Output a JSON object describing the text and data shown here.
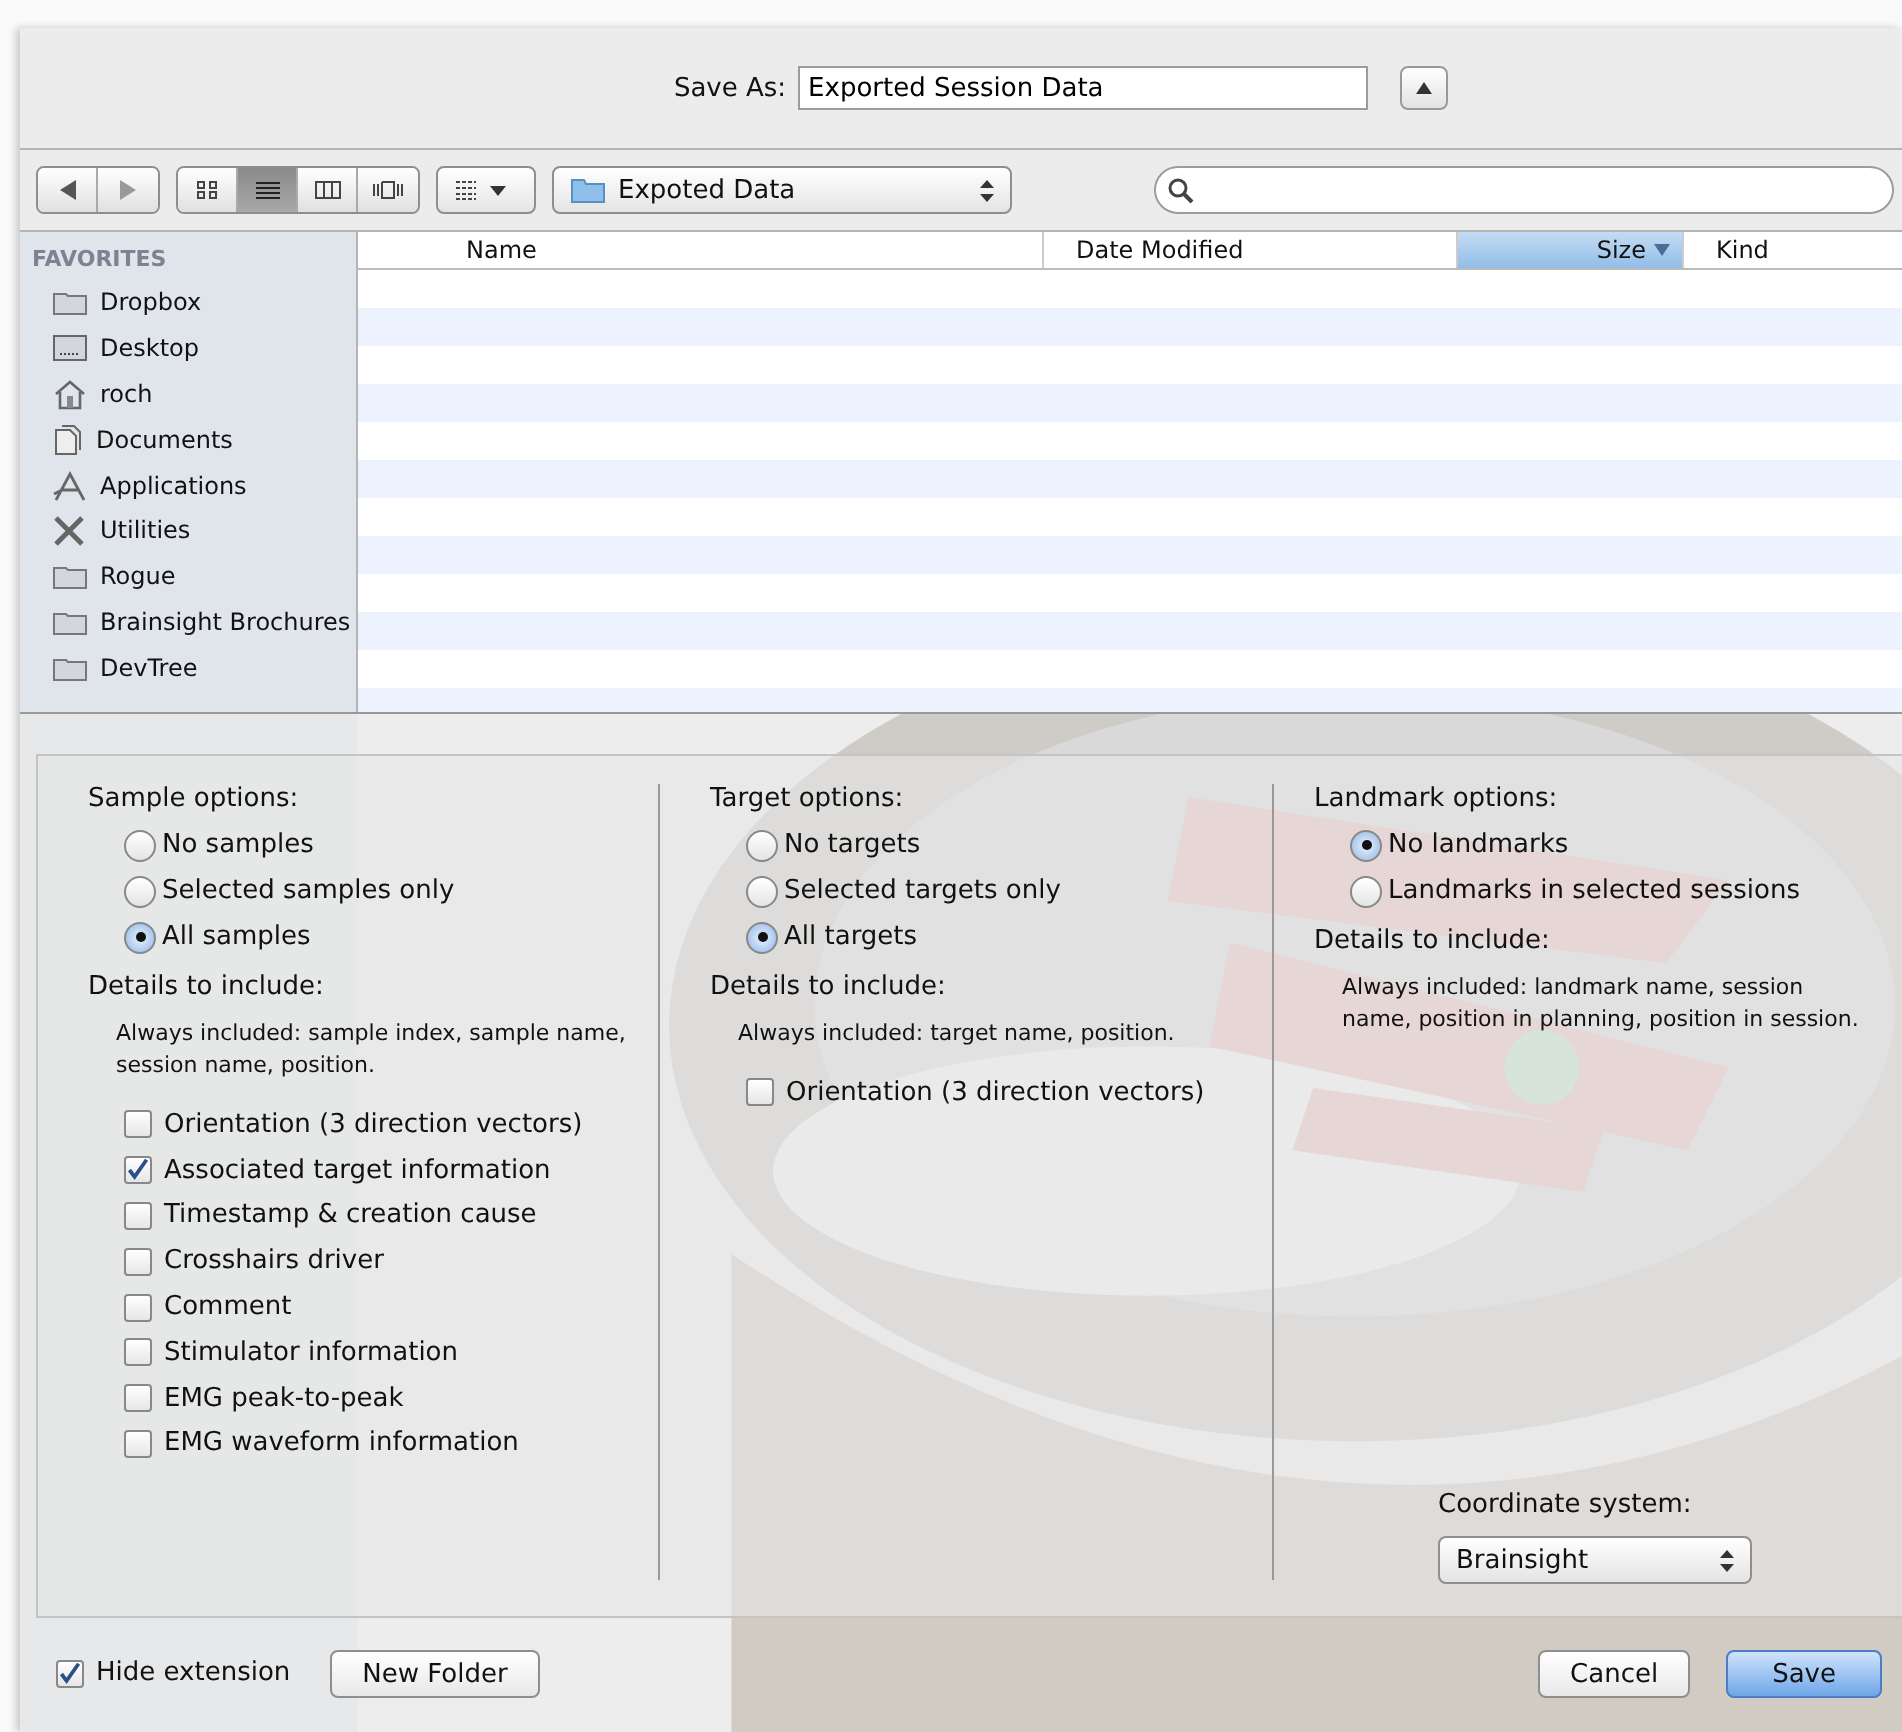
{
  "save_as": {
    "label": "Save As:",
    "value": "Exported Session Data",
    "expanded": true
  },
  "toolbar": {
    "view_modes": [
      {
        "kind": "icons",
        "selected": false
      },
      {
        "kind": "list",
        "selected": true
      },
      {
        "kind": "columns",
        "selected": false
      },
      {
        "kind": "coverflow",
        "selected": false
      }
    ],
    "location": "Expoted Data"
  },
  "sidebar": {
    "heading": "FAVORITES",
    "items": [
      {
        "label": "Dropbox",
        "kind": "folder"
      },
      {
        "label": "Desktop",
        "kind": "desktop"
      },
      {
        "label": "roch",
        "kind": "home"
      },
      {
        "label": "Documents",
        "kind": "documents"
      },
      {
        "label": "Applications",
        "kind": "applications"
      },
      {
        "label": "Utilities",
        "kind": "utilities"
      },
      {
        "label": "Rogue",
        "kind": "folder"
      },
      {
        "label": "Brainsight Brochures",
        "kind": "folder"
      },
      {
        "label": "DevTree",
        "kind": "folder"
      }
    ]
  },
  "file_list": {
    "columns": [
      {
        "label": "Name",
        "selected": false
      },
      {
        "label": "Date Modified",
        "selected": false
      },
      {
        "label": "Size",
        "selected": true
      },
      {
        "label": "Kind",
        "selected": false
      }
    ]
  },
  "panels": [
    {
      "title": "Sample options:",
      "radios": [
        {
          "label": "No samples",
          "selected": false
        },
        {
          "label": "Selected samples only",
          "selected": false
        },
        {
          "label": "All samples",
          "selected": true
        }
      ],
      "details_title": "Details to include:",
      "note": "Always included: sample index, sample name, session name, position.",
      "checkboxes": [
        {
          "label": "Orientation (3 direction vectors)",
          "checked": false
        },
        {
          "label": "Associated target information",
          "checked": true
        },
        {
          "label": "Timestamp & creation cause",
          "checked": false
        },
        {
          "label": "Crosshairs driver",
          "checked": false
        },
        {
          "label": "Comment",
          "checked": false
        },
        {
          "label": "Stimulator information",
          "checked": false
        },
        {
          "label": "EMG peak-to-peak",
          "checked": false
        },
        {
          "label": "EMG waveform information",
          "checked": false
        }
      ]
    },
    {
      "title": "Target options:",
      "radios": [
        {
          "label": "No targets",
          "selected": false
        },
        {
          "label": "Selected targets only",
          "selected": false
        },
        {
          "label": "All targets",
          "selected": true
        }
      ],
      "details_title": "Details to include:",
      "note": "Always included: target name, position.",
      "checkboxes": [
        {
          "label": "Orientation (3 direction vectors)",
          "checked": false
        }
      ]
    },
    {
      "title": "Landmark options:",
      "radios": [
        {
          "label": "No landmarks",
          "selected": true
        },
        {
          "label": "Landmarks in selected sessions",
          "selected": false
        }
      ],
      "details_title": "Details to include:",
      "note": "Always included: landmark name, session name, position in planning, position in session."
    }
  ],
  "coordinate_system": {
    "label": "Coordinate system:",
    "value": "Brainsight"
  },
  "footer": {
    "hide_extension": {
      "label": "Hide extension",
      "checked": true
    },
    "new_folder": "New Folder",
    "cancel": "Cancel",
    "save": "Save"
  }
}
